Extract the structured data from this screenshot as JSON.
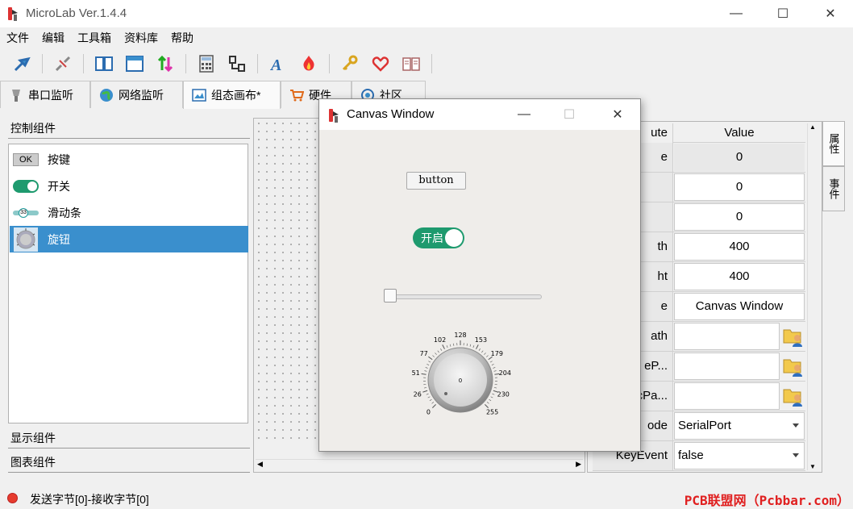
{
  "app": {
    "title": "MicroLab Ver.1.4.4"
  },
  "window_controls": {
    "minimize": "—",
    "maximize": "☐",
    "close": "✕"
  },
  "menu": [
    "文件",
    "编辑",
    "工具箱",
    "资料库",
    "帮助"
  ],
  "tabs": [
    {
      "label": "串口监听",
      "icon": "serial-port-icon"
    },
    {
      "label": "网络监听",
      "icon": "globe-icon"
    },
    {
      "label": "组态画布*",
      "icon": "canvas-icon"
    },
    {
      "label": "硬件",
      "icon": "cart-icon"
    },
    {
      "label": "社区",
      "icon": "community-icon"
    }
  ],
  "left_panel": {
    "control_header": "控制组件",
    "components": [
      {
        "label": "按键",
        "icon_text": "OK"
      },
      {
        "label": "开关"
      },
      {
        "label": "滑动条",
        "icon_text": "33"
      },
      {
        "label": "旋钮"
      }
    ],
    "display_header": "显示组件",
    "chart_header": "图表组件"
  },
  "properties": {
    "header_attribute": "ute",
    "header_value": "Value",
    "rows": [
      {
        "key": "e",
        "value": "0"
      },
      {
        "key": "",
        "value": "0"
      },
      {
        "key": "",
        "value": "0"
      },
      {
        "key": "th",
        "value": "400"
      },
      {
        "key": "ht",
        "value": "400"
      },
      {
        "key": "e",
        "value": "Canvas Window"
      },
      {
        "key": "ath",
        "value": ""
      },
      {
        "key": "eP...",
        "value": ""
      },
      {
        "key": "cPa...",
        "value": ""
      },
      {
        "key": "ode",
        "value": "SerialPort"
      },
      {
        "key": "KeyEvent",
        "value": "false"
      }
    ]
  },
  "side_tabs": [
    "属性",
    "事件"
  ],
  "canvas_window": {
    "title": "Canvas Window",
    "button_label": "button",
    "switch_label": "开启",
    "slider_value": 0,
    "knob": {
      "value": "0",
      "ticks": [
        "0",
        "26",
        "51",
        "77",
        "102",
        "128",
        "153",
        "179",
        "204",
        "230",
        "255"
      ]
    }
  },
  "status": {
    "text": "发送字节[0]-接收字节[0]",
    "watermark": "PCB联盟网（Pcbbar.com）"
  },
  "colors": {
    "accent": "#1e9a6e",
    "selection": "#3a8fcd",
    "status_dot": "#e63b2e"
  }
}
